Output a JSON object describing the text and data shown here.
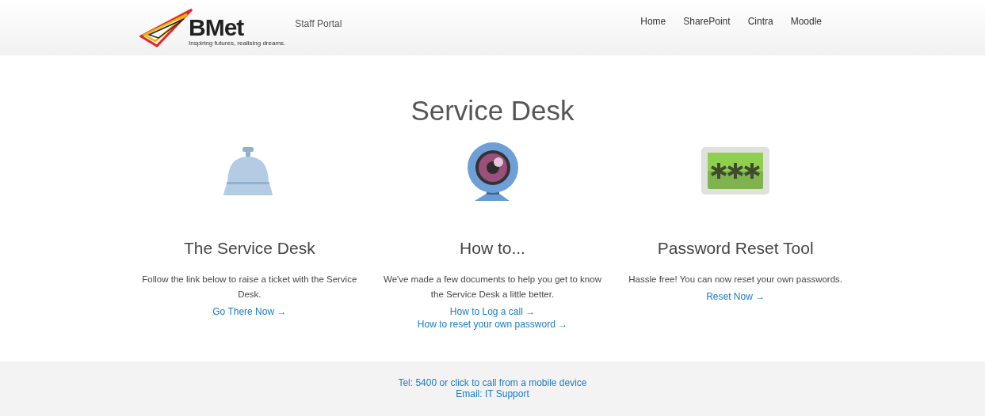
{
  "header": {
    "logo_text": "BMet",
    "tagline": "Inspiring futures, realising dreams.",
    "portal_name": "Staff Portal",
    "nav": [
      "Home",
      "SharePoint",
      "Cintra",
      "Moodle"
    ]
  },
  "page_title": "Service Desk",
  "columns": [
    {
      "heading": "The Service Desk",
      "text": "Follow the link below to raise a ticket with the Service Desk.",
      "links": [
        "Go There Now →"
      ]
    },
    {
      "heading": "How to...",
      "text": "We've made a few documents to help you get to know the Service Desk a little better.",
      "links": [
        "How to Log a call →",
        "How to reset your own password →"
      ]
    },
    {
      "heading": "Password Reset Tool",
      "text": "Hassle free! You can now reset your own passwords.",
      "links": [
        "Reset Now →"
      ]
    }
  ],
  "footer": {
    "lines": [
      "Tel: 5400 or click to call from a mobile device",
      "Email: IT Support"
    ]
  }
}
